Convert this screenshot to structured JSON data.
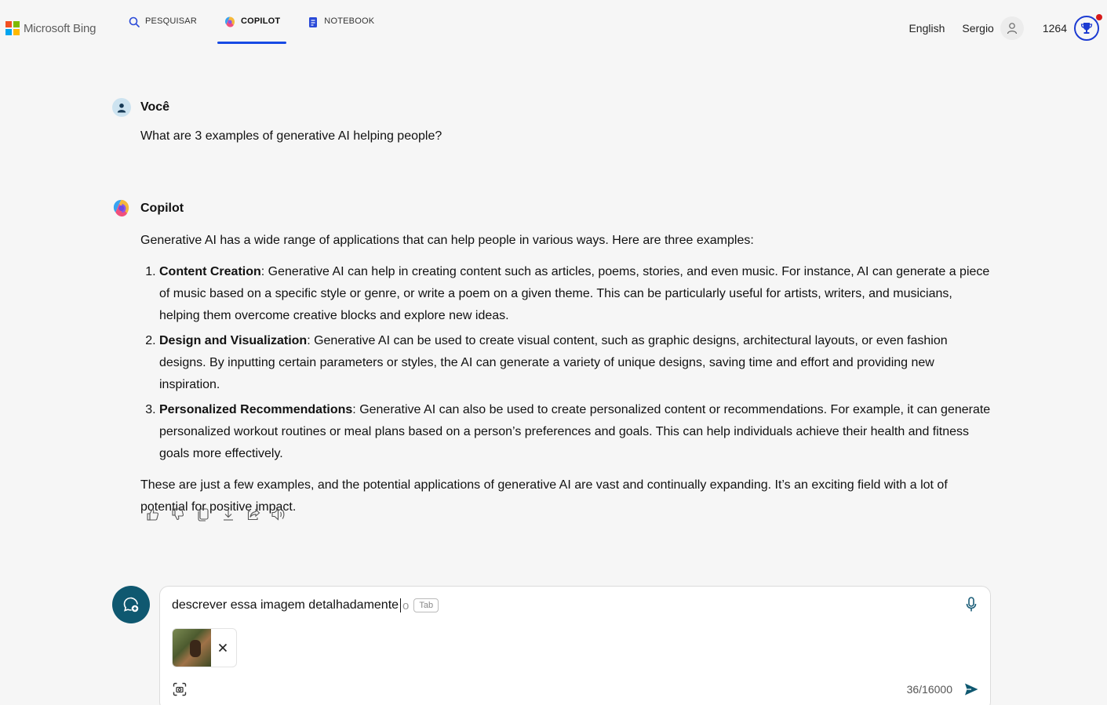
{
  "brand": {
    "name": "Microsoft Bing",
    "logo_colors": [
      "#f25022",
      "#7fba00",
      "#00a4ef",
      "#ffb900"
    ]
  },
  "nav": {
    "tabs": [
      {
        "label": "PESQUISAR",
        "icon": "search-icon",
        "active": false
      },
      {
        "label": "COPILOT",
        "icon": "copilot-icon",
        "active": true
      },
      {
        "label": "NOTEBOOK",
        "icon": "notebook-icon",
        "active": false
      }
    ]
  },
  "header_right": {
    "language": "English",
    "user_name": "Sergio",
    "points": "1264",
    "avatar_icon": "person-icon",
    "rewards_icon": "trophy-icon"
  },
  "conversation": {
    "user": {
      "name": "Você",
      "message": "What are 3 examples of generative AI helping people?"
    },
    "copilot": {
      "name": "Copilot",
      "intro": "Generative AI has a wide range of applications that can help people in various ways. Here are three examples:",
      "items": [
        {
          "title": "Content Creation",
          "text": ": Generative AI can help in creating content such as articles, poems, stories, and even music. For instance, AI can generate a piece of music based on a specific style or genre, or write a poem on a given theme. This can be particularly useful for artists, writers, and musicians, helping them overcome creative blocks and explore new ideas."
        },
        {
          "title": "Design and Visualization",
          "text": ": Generative AI can be used to create visual content, such as graphic designs, architectural layouts, or even fashion designs. By inputting certain parameters or styles, the AI can generate a variety of unique designs, saving time and effort and providing new inspiration."
        },
        {
          "title": "Personalized Recommendations",
          "text": ": Generative AI can also be used to create personalized content or recommendations. For example, it can generate personalized workout routines or meal plans based on a person’s preferences and goals. This can help individuals achieve their health and fitness goals more effectively."
        }
      ],
      "outro": "These are just a few examples, and the potential applications of generative AI are vast and continually expanding. It’s an exciting field with a lot of potential for positive impact.",
      "actions": [
        "thumbs-up-icon",
        "thumbs-down-icon",
        "copy-icon",
        "download-icon",
        "share-icon",
        "read-aloud-icon"
      ]
    }
  },
  "composer": {
    "input_value": "descrever essa imagem detalhadamente",
    "suggestion": "o",
    "tab_hint": "Tab",
    "char_count": "36/16000",
    "attachment": {
      "type": "image",
      "remove_icon": "close-icon"
    }
  },
  "colors": {
    "accent": "#174ae4",
    "new_topic_bg": "#0f5870",
    "send": "#0f5870",
    "background": "#f6f6f6"
  }
}
